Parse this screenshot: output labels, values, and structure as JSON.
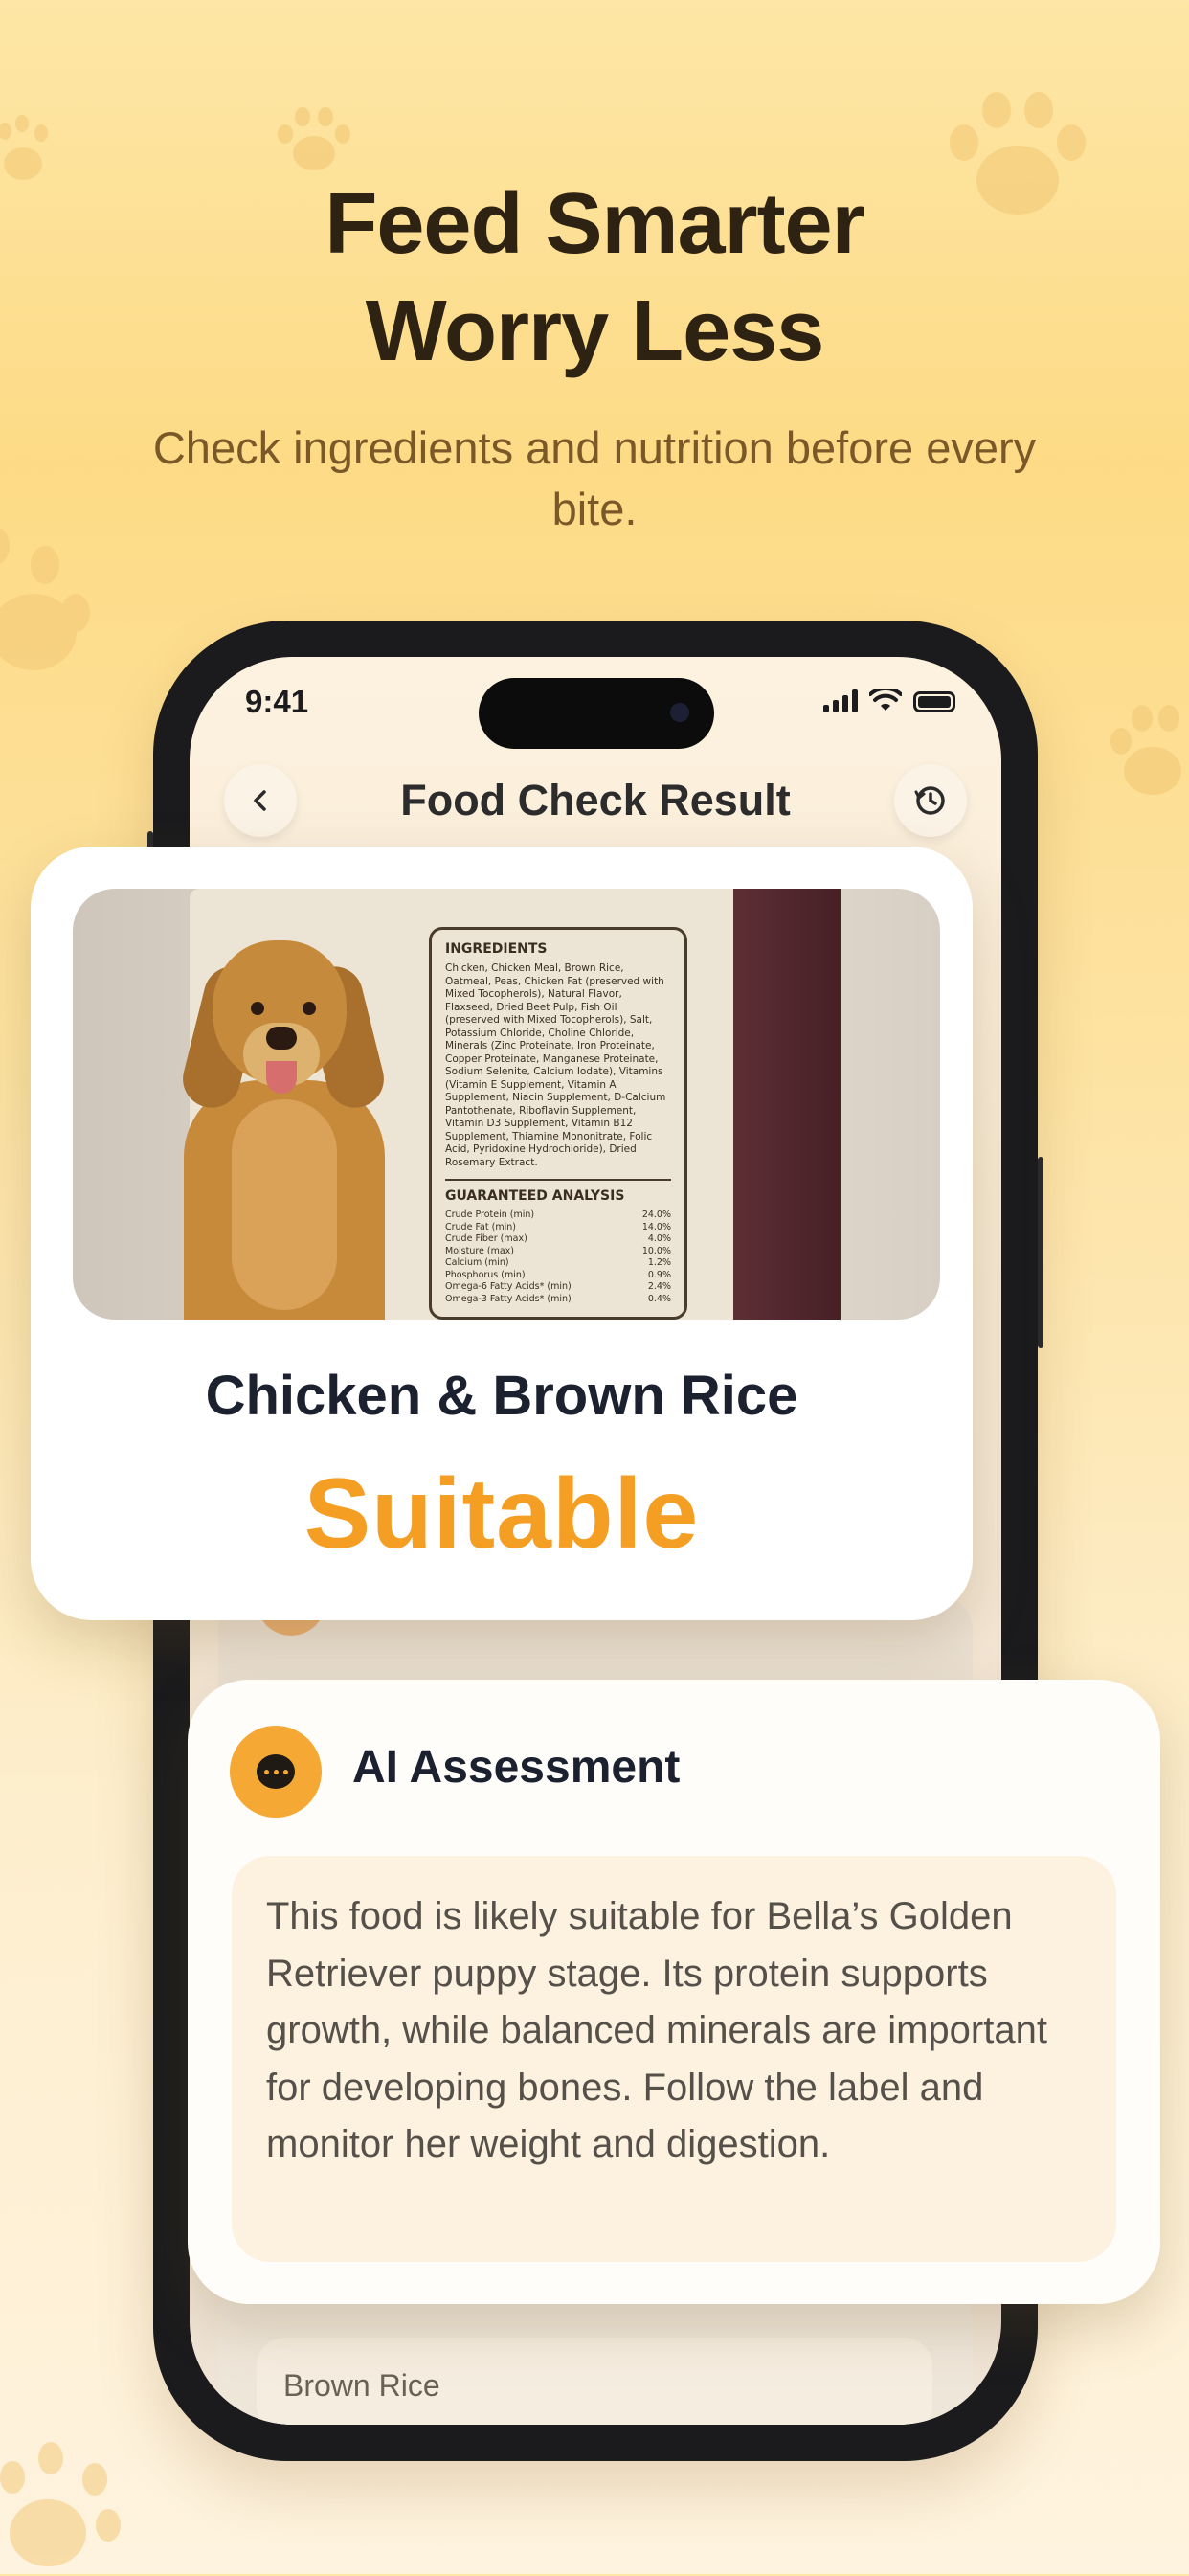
{
  "hero": {
    "title_line1": "Feed Smarter",
    "title_line2": "Worry Less",
    "subtitle": "Check ingredients and nutrition before every bite."
  },
  "status_bar": {
    "time": "9:41"
  },
  "nav": {
    "title": "Food Check Result",
    "back_icon": "chevron-left-icon",
    "history_icon": "history-icon"
  },
  "product_photo": {
    "ingredients_title": "INGREDIENTS",
    "ingredients_text": "Chicken, Chicken Meal, Brown Rice, Oatmeal, Peas, Chicken Fat (preserved with Mixed Tocopherols), Natural Flavor, Flaxseed, Dried Beet Pulp, Fish Oil (preserved with Mixed Tocopherols), Salt, Potassium Chloride, Choline Chloride, Minerals (Zinc Proteinate, Iron Proteinate, Copper Proteinate, Manganese Proteinate, Sodium Selenite, Calcium Iodate), Vitamins (Vitamin E Supplement, Vitamin A Supplement, Niacin Supplement, D-Calcium Pantothenate, Riboflavin Supplement, Vitamin D3 Supplement, Vitamin B12 Supplement, Thiamine Mononitrate, Folic Acid, Pyridoxine Hydrochloride), Dried Rosemary Extract.",
    "analysis_title": "GUARANTEED ANALYSIS",
    "analysis_rows": [
      {
        "name": "Crude Protein (min)",
        "value": "24.0%"
      },
      {
        "name": "Crude Fat (min)",
        "value": "14.0%"
      },
      {
        "name": "Crude Fiber (max)",
        "value": "4.0%"
      },
      {
        "name": "Moisture (max)",
        "value": "10.0%"
      },
      {
        "name": "Calcium (min)",
        "value": "1.2%"
      },
      {
        "name": "Phosphorus (min)",
        "value": "0.9%"
      },
      {
        "name": "Omega-6 Fatty Acids* (min)",
        "value": "2.4%"
      },
      {
        "name": "Omega-3 Fatty Acids* (min)",
        "value": "0.4%"
      }
    ]
  },
  "result": {
    "food_name": "Chicken & Brown Rice",
    "verdict": "Suitable",
    "verdict_color": "#f59e24"
  },
  "ai_assessment": {
    "title": "AI Assessment",
    "icon": "chat-bubble-icon",
    "body": "This food is likely suitable for Bella’s Golden Retriever puppy stage. Its protein supports growth, while balanced minerals are important for developing bones. Follow the label and monitor her weight and digestion."
  },
  "background_screen": {
    "ingredient_chip": "Brown Rice"
  },
  "colors": {
    "accent": "#f5a833",
    "title": "#2e2212",
    "subtitle": "#7a5828"
  }
}
